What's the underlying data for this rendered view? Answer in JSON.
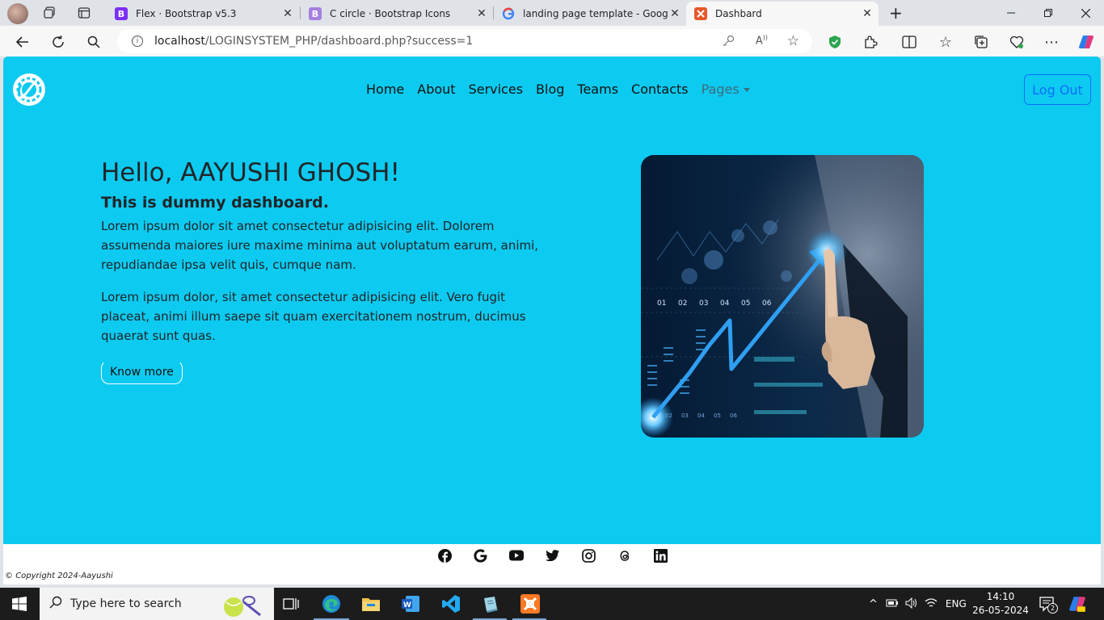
{
  "browser": {
    "tabs": [
      {
        "title": "Flex · Bootstrap v5.3",
        "favicon": "B",
        "color": "#7b2ff7",
        "active": false
      },
      {
        "title": "C circle · Bootstrap Icons",
        "favicon": "B",
        "color": "#a67fe0",
        "active": false
      },
      {
        "title": "landing page template - Google",
        "favicon": "G",
        "color": "#ffffff",
        "active": false
      },
      {
        "title": "Dashbard",
        "favicon": "X",
        "color": "#e8572a",
        "active": true
      }
    ],
    "url_host": "localhost",
    "url_path": "/LOGINSYSTEM_PHP/dashboard.php?success=1"
  },
  "navbar": {
    "items": [
      "Home",
      "About",
      "Services",
      "Blog",
      "Teams",
      "Contacts"
    ],
    "dropdown": "Pages",
    "logout": "Log Out"
  },
  "hero": {
    "greeting": "Hello, AAYUSHI GHOSH!",
    "subtitle": "This is dummy dashboard.",
    "para1": "Lorem ipsum dolor sit amet consectetur adipisicing elit. Dolorem assumenda maiores iure maxime minima aut voluptatum earum, animi, repudiandae ipsa velit quis, cumque nam.",
    "para2": "Lorem ipsum dolor, sit amet consectetur adipisicing elit. Vero fugit placeat, animi illum saepe sit quam exercitationem nostrum, ducimus quaerat sunt quas.",
    "button": "Know more",
    "image_labels": [
      "01",
      "02",
      "03",
      "04",
      "05",
      "06"
    ],
    "image_labels_bottom": [
      "02",
      "03",
      "04",
      "05",
      "06"
    ]
  },
  "footer": {
    "icons": [
      "facebook-icon",
      "google-icon",
      "youtube-icon",
      "twitter-icon",
      "instagram-icon",
      "threads-icon",
      "linkedin-icon"
    ],
    "copyright": "Copyright 2024-Aayushi"
  },
  "taskbar": {
    "search_placeholder": "Type here to search",
    "lang": "ENG",
    "time": "14:10",
    "date": "26-05-2024",
    "notifications": "2"
  },
  "colors": {
    "page_bg": "#0dcaf0",
    "accent": "#0d6efd"
  }
}
